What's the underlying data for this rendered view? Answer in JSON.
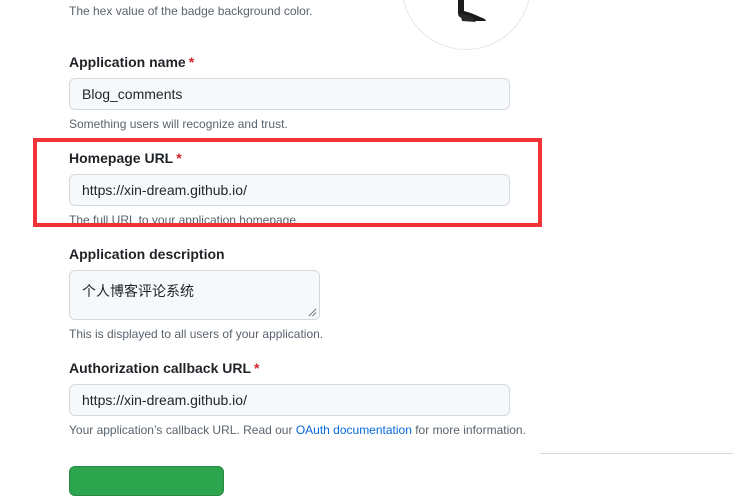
{
  "badge_color": {
    "help": "The hex value of the badge background color."
  },
  "app_name": {
    "label": "Application name",
    "required_mark": "*",
    "value": "Blog_comments",
    "help": "Something users will recognize and trust."
  },
  "homepage_url": {
    "label": "Homepage URL",
    "required_mark": "*",
    "value": "https://xin-dream.github.io/",
    "help": "The full URL to your application homepage."
  },
  "description": {
    "label": "Application description",
    "value": "个人博客评论系统",
    "help": "This is displayed to all users of your application."
  },
  "callback_url": {
    "label": "Authorization callback URL",
    "required_mark": "*",
    "value": "https://xin-dream.github.io/",
    "help_prefix": "Your application’s callback URL. Read our ",
    "help_link": "OAuth documentation",
    "help_suffix": " for more information."
  },
  "colors": {
    "highlight": "#ef3337",
    "link": "#0969da",
    "required": "#d1242f",
    "submit_button": "#2da44e"
  },
  "icons": {
    "avatar": "app-logo-avatar",
    "textarea_resize": "resize-grip-icon"
  }
}
